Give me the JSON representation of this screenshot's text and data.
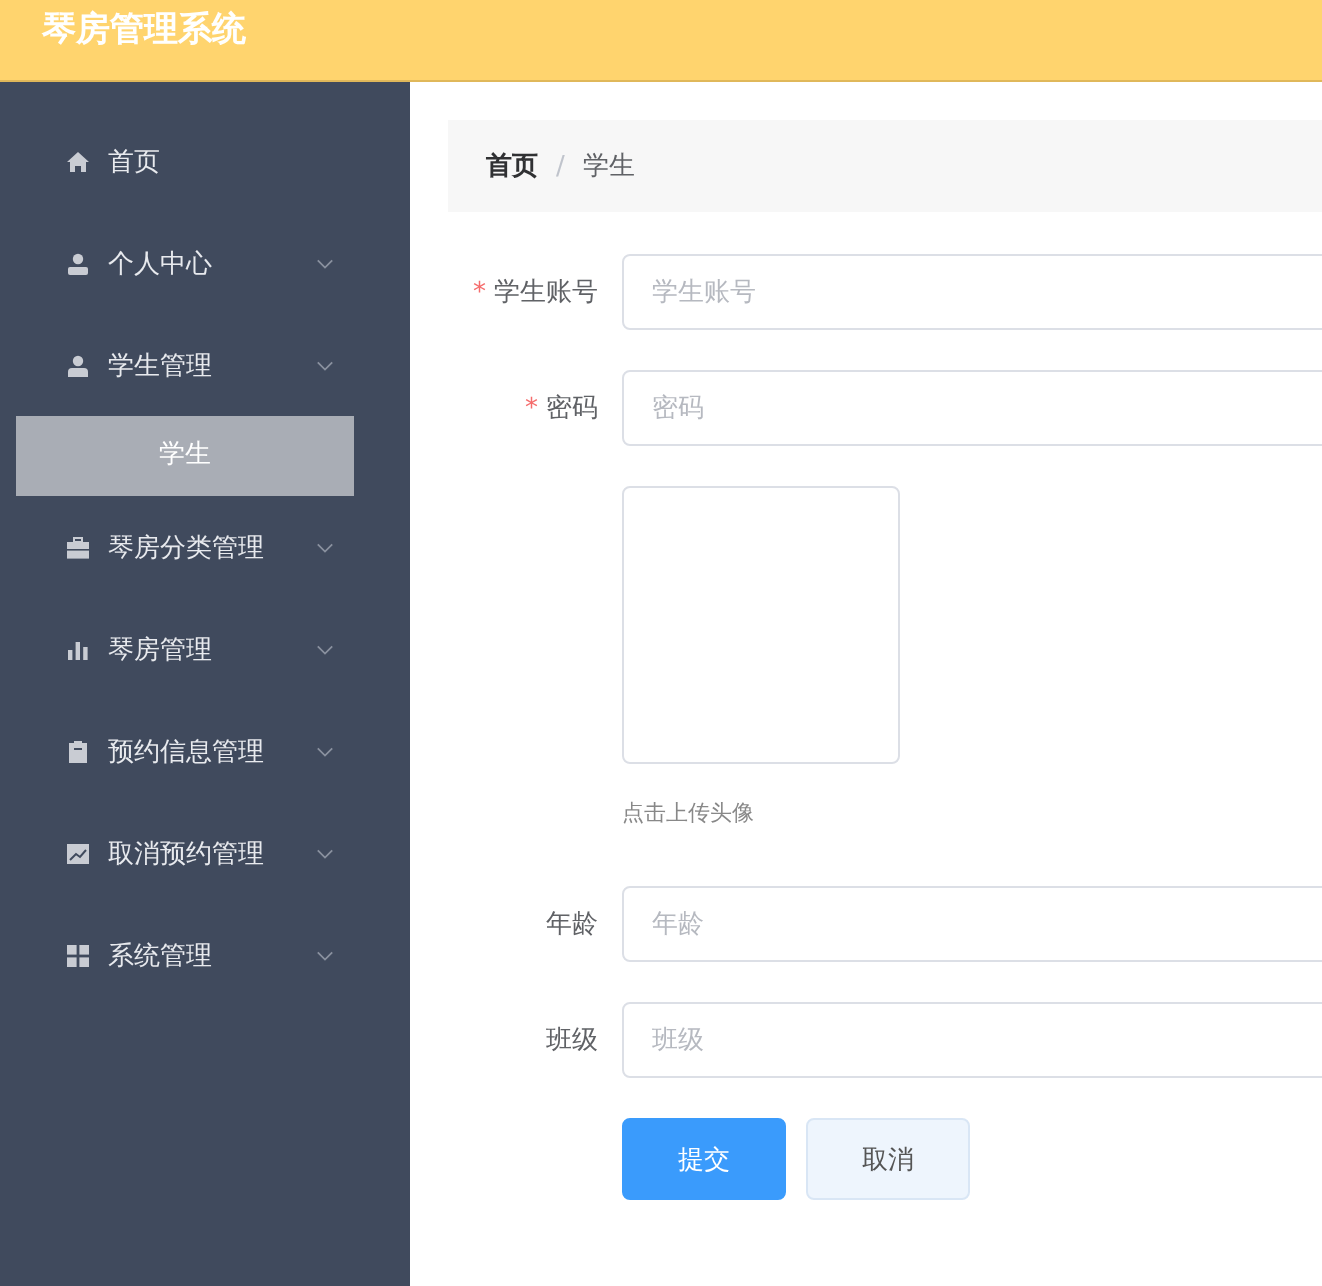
{
  "header": {
    "title": "琴房管理系统"
  },
  "sidebar": {
    "items": [
      {
        "label": "首页",
        "kind": "home",
        "submenu": false
      },
      {
        "label": "个人中心",
        "kind": "user",
        "submenu": true
      },
      {
        "label": "学生管理",
        "kind": "user-badge",
        "submenu": true,
        "children": [
          {
            "label": "学生",
            "selected": true
          }
        ]
      },
      {
        "label": "琴房分类管理",
        "kind": "case",
        "submenu": true
      },
      {
        "label": "琴房管理",
        "kind": "bars",
        "submenu": true
      },
      {
        "label": "预约信息管理",
        "kind": "clipboard",
        "submenu": true
      },
      {
        "label": "取消预约管理",
        "kind": "chart",
        "submenu": true
      },
      {
        "label": "系统管理",
        "kind": "grid",
        "submenu": true
      }
    ]
  },
  "breadcrumb": {
    "separator": "/",
    "items": [
      "首页",
      "学生"
    ]
  },
  "form": {
    "fields": [
      {
        "kind": "input",
        "label": "学生账号",
        "required_mark": "*",
        "placeholder": "学生账号"
      },
      {
        "kind": "input",
        "label": "密码",
        "required_mark": "*",
        "placeholder": "密码"
      },
      {
        "kind": "upload",
        "hint": "点击上传头像"
      },
      {
        "kind": "input",
        "label": "年龄",
        "placeholder": "年龄"
      },
      {
        "kind": "input",
        "label": "班级",
        "placeholder": "班级"
      }
    ],
    "buttons": [
      {
        "label": "提交",
        "kind": "primary"
      },
      {
        "label": "取消",
        "kind": "default"
      }
    ]
  }
}
